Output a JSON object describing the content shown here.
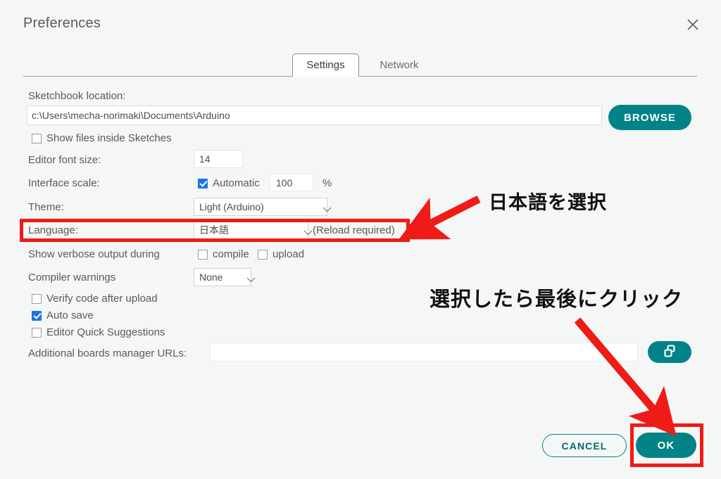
{
  "dialog": {
    "title": "Preferences",
    "close_icon": "close-icon"
  },
  "tabs": [
    {
      "label": "Settings",
      "active": true
    },
    {
      "label": "Network",
      "active": false
    }
  ],
  "settings": {
    "sketchbook_label": "Sketchbook location:",
    "sketchbook_path": "c:\\Users\\mecha-norimaki\\Documents\\Arduino",
    "browse_label": "BROWSE",
    "show_files_label": "Show files inside Sketches",
    "show_files_checked": false,
    "editor_font_size_label": "Editor font size:",
    "editor_font_size_value": "14",
    "interface_scale_label": "Interface scale:",
    "automatic_label": "Automatic",
    "automatic_checked": true,
    "scale_value": "100",
    "percent_sign": "%",
    "theme_label": "Theme:",
    "theme_value": "Light (Arduino)",
    "language_label": "Language:",
    "language_value": "日本語",
    "reload_note": "(Reload required)",
    "verbose_label": "Show verbose output during",
    "compile_label": "compile",
    "compile_checked": false,
    "upload_label": "upload",
    "upload_checked": false,
    "compiler_warnings_label": "Compiler warnings",
    "compiler_warnings_value": "None",
    "verify_label": "Verify code after upload",
    "verify_checked": false,
    "autosave_label": "Auto save",
    "autosave_checked": true,
    "quick_suggestions_label": "Editor Quick Suggestions",
    "quick_suggestions_checked": false,
    "urls_label": "Additional boards manager URLs:",
    "urls_value": "",
    "urls_button_icon": "open-window-icon"
  },
  "footer": {
    "cancel_label": "CANCEL",
    "ok_label": "OK"
  },
  "annotations": {
    "note_language": "日本語を選択",
    "note_click": "選択したら最後にクリック",
    "highlight_color": "#f01a16",
    "arrow_color": "#ee1b17"
  },
  "colors": {
    "accent_teal": "#018387",
    "checkbox_blue": "#1a73e8",
    "background": "#f5f6f6",
    "text": "#5a5a5a"
  }
}
